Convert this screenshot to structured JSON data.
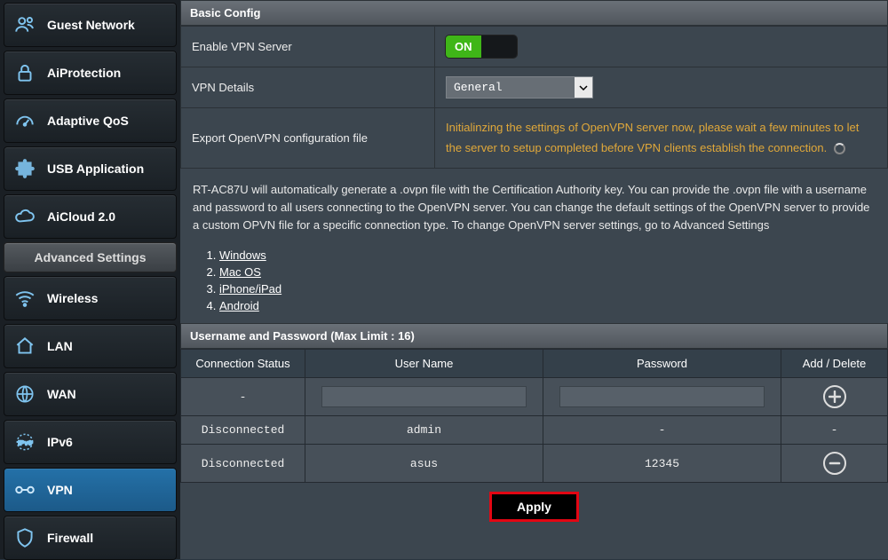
{
  "sidebar": {
    "items": [
      {
        "label": "Guest Network"
      },
      {
        "label": "AiProtection"
      },
      {
        "label": "Adaptive QoS"
      },
      {
        "label": "USB Application"
      },
      {
        "label": "AiCloud 2.0"
      }
    ],
    "advanced_header": "Advanced Settings",
    "adv": [
      {
        "label": "Wireless"
      },
      {
        "label": "LAN"
      },
      {
        "label": "WAN"
      },
      {
        "label": "IPv6"
      },
      {
        "label": "VPN"
      },
      {
        "label": "Firewall"
      }
    ]
  },
  "basic": {
    "title": "Basic Config",
    "enable_label": "Enable VPN Server",
    "switch_on": "ON",
    "details_label": "VPN Details",
    "details_value": "General",
    "export_label": "Export OpenVPN configuration file",
    "export_status": "Initialinzing the settings of OpenVPN server now, please wait a few minutes to let the server to setup completed before VPN clients establish the connection."
  },
  "desc": "RT-AC87U will automatically generate a .ovpn file with the Certification Authority key. You can provide the .ovpn file with a username and password to all users connecting to the OpenVPN server. You can change the default settings of the OpenVPN server to provide a custom OPVN file for a specific connection type. To change OpenVPN server settings, go to Advanced Settings",
  "os": [
    "Windows",
    "Mac OS",
    "iPhone/iPad",
    "Android"
  ],
  "usersec": {
    "title": "Username and Password (Max Limit : 16)",
    "h_status": "Connection Status",
    "h_user": "User Name",
    "h_pass": "Password",
    "h_action": "Add / Delete",
    "rows": [
      {
        "status": "-",
        "user": "",
        "pass": "",
        "action": "add",
        "input": true
      },
      {
        "status": "Disconnected",
        "user": "admin",
        "pass": "-",
        "action": "none"
      },
      {
        "status": "Disconnected",
        "user": "asus",
        "pass": "12345",
        "action": "delete"
      }
    ]
  },
  "apply": "Apply"
}
